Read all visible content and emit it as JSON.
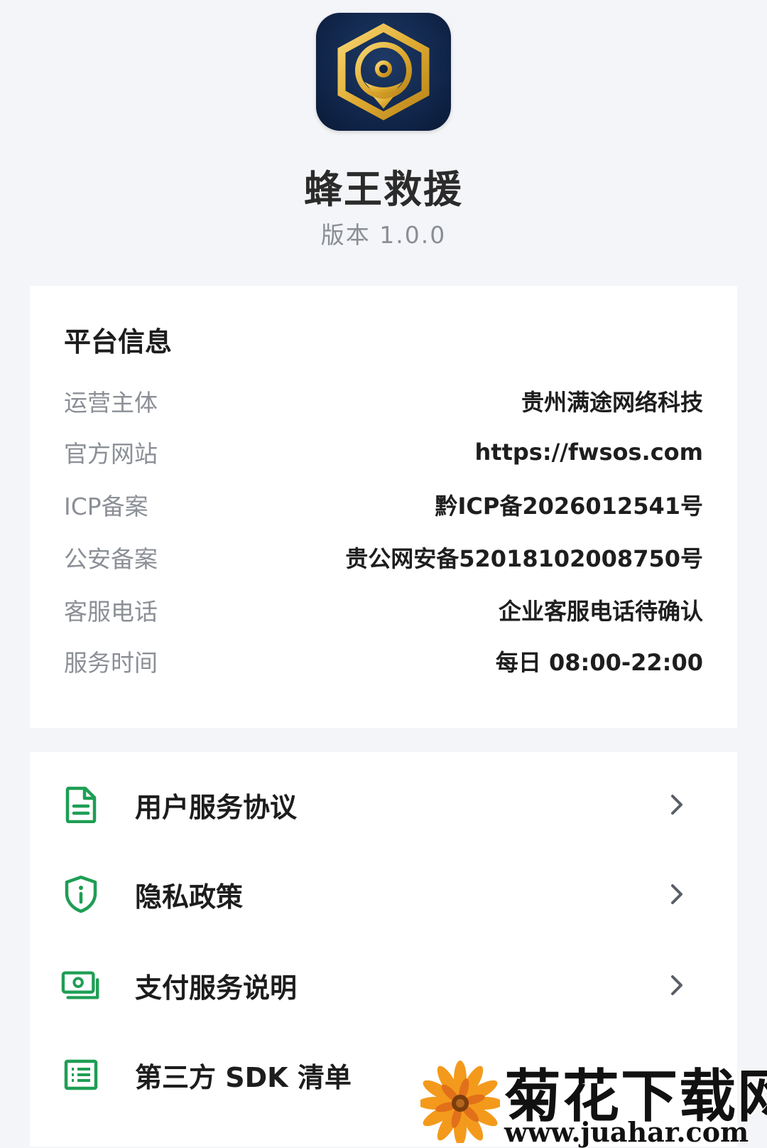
{
  "app": {
    "name": "蜂王救援",
    "version": "版本 1.0.0",
    "icon": "hexagon-bee-logo-icon"
  },
  "platform_info": {
    "title": "平台信息",
    "rows": [
      {
        "label": "运营主体",
        "value": "贵州满途网络科技"
      },
      {
        "label": "官方网站",
        "value": "https://fwsos.com"
      },
      {
        "label": "ICP备案",
        "value": "黔ICP备2026012541号"
      },
      {
        "label": "公安备案",
        "value": "贵公网安备52018102008750号"
      },
      {
        "label": "客服电话",
        "value": "企业客服电话待确认"
      },
      {
        "label": "服务时间",
        "value": "每日 08:00-22:00"
      }
    ]
  },
  "menu": {
    "items": [
      {
        "label": "用户服务协议",
        "icon": "document-icon"
      },
      {
        "label": "隐私政策",
        "icon": "shield-info-icon"
      },
      {
        "label": "支付服务说明",
        "icon": "banknote-icon"
      },
      {
        "label": "第三方 SDK 清单",
        "icon": "list-icon"
      }
    ]
  },
  "colors": {
    "accent_green": "#1e9e54",
    "background": "#f4f5f8",
    "card": "#ffffff",
    "label_gray": "#8b8f96",
    "logo_gold": "#e3b23c",
    "logo_navy": "#0f2346"
  },
  "watermark": {
    "title": "菊花下载网",
    "url": "www.juahar.com"
  }
}
